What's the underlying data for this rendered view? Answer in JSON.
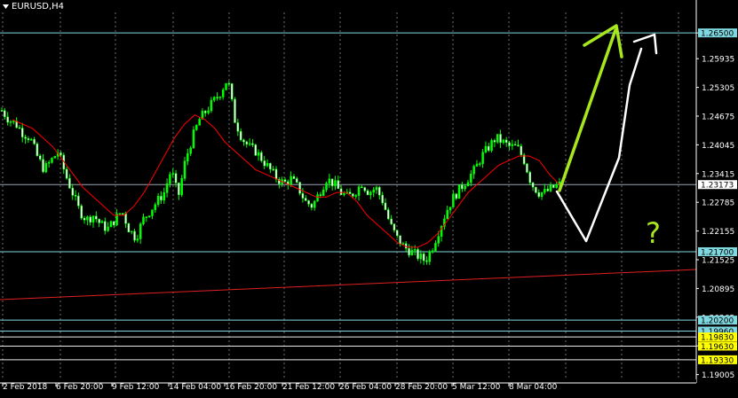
{
  "window": {
    "symbol_label": "EURUSD,H4"
  },
  "chart_data": {
    "type": "candlestick",
    "symbol": "EURUSD",
    "timeframe": "H4",
    "ylim": [
      1.189,
      1.2695
    ],
    "y_ticks": [
      1.265,
      1.25935,
      1.25305,
      1.24675,
      1.24045,
      1.23415,
      1.22785,
      1.22155,
      1.21525,
      1.20895,
      1.20265,
      1.19635,
      1.19005
    ],
    "x_ticks": [
      "2 Feb 2018",
      "6 Feb 20:00",
      "9 Feb 12:00",
      "14 Feb 04:00",
      "16 Feb 20:00",
      "21 Feb 12:00",
      "26 Feb 04:00",
      "28 Feb 20:00",
      "5 Mar 12:00",
      "8 Mar 04:00"
    ],
    "grid": true,
    "colors": {
      "background": "#000000",
      "bull_candle": "#00ff00",
      "bear_candle": "#ffffff",
      "moving_average": "#ff0000",
      "level_line": "#7fd8e0",
      "trend_line": "#e02020",
      "current_price_label": "#ffffff",
      "highlight_label": "#ffff00",
      "green_arrow": "#a8e61e",
      "white_arrow": "#ffffff"
    },
    "price_path": [
      1.248,
      1.246,
      1.245,
      1.243,
      1.242,
      1.238,
      1.235,
      1.237,
      1.239,
      1.234,
      1.23,
      1.226,
      1.224,
      1.225,
      1.223,
      1.222,
      1.224,
      1.226,
      1.222,
      1.22,
      1.224,
      1.226,
      1.228,
      1.23,
      1.235,
      1.229,
      1.237,
      1.242,
      1.246,
      1.248,
      1.25,
      1.252,
      1.255,
      1.246,
      1.242,
      1.24,
      1.239,
      1.237,
      1.235,
      1.233,
      1.232,
      1.233,
      1.231,
      1.228,
      1.227,
      1.23,
      1.233,
      1.232,
      1.23,
      1.229,
      1.23,
      1.232,
      1.23,
      1.231,
      1.228,
      1.223,
      1.22,
      1.218,
      1.217,
      1.216,
      1.215,
      1.218,
      1.222,
      1.226,
      1.229,
      1.231,
      1.233,
      1.235,
      1.238,
      1.24,
      1.242,
      1.241,
      1.24,
      1.24,
      1.237,
      1.232,
      1.23,
      1.23,
      1.231,
      1.2317
    ],
    "ma_path": [
      1.246,
      1.245,
      1.244,
      1.242,
      1.24,
      1.237,
      1.234,
      1.231,
      1.229,
      1.227,
      1.225,
      1.225,
      1.227,
      1.23,
      1.234,
      1.238,
      1.242,
      1.245,
      1.247,
      1.246,
      1.244,
      1.241,
      1.239,
      1.237,
      1.235,
      1.234,
      1.233,
      1.232,
      1.231,
      1.23,
      1.229,
      1.229,
      1.23,
      1.23,
      1.228,
      1.225,
      1.223,
      1.221,
      1.219,
      1.218,
      1.218,
      1.219,
      1.221,
      1.224,
      1.227,
      1.23,
      1.232,
      1.234,
      1.236,
      1.237,
      1.238,
      1.238,
      1.237,
      1.234,
      1.2317
    ],
    "levels": [
      {
        "price": 1.265,
        "label": "1.26500",
        "style": "cyan"
      },
      {
        "price": 1.217,
        "label": "1.21700",
        "style": "cyan"
      },
      {
        "price": 1.202,
        "label": "1.20200",
        "style": "cyan"
      },
      {
        "price": 1.1996,
        "label": "1.19960",
        "style": "cyan"
      },
      {
        "price": 1.1983,
        "label": "1.19830",
        "style": "yellow"
      },
      {
        "price": 1.1963,
        "label": "1.19630",
        "style": "yellow"
      },
      {
        "price": 1.1933,
        "label": "1.19330",
        "style": "yellow"
      }
    ],
    "current_price": {
      "price": 1.23173,
      "label": "1.23173"
    },
    "trend_line": {
      "from_price": 1.2065,
      "to_price": 1.2131
    },
    "annotations": [
      {
        "type": "question-mark",
        "text": "?"
      }
    ]
  }
}
